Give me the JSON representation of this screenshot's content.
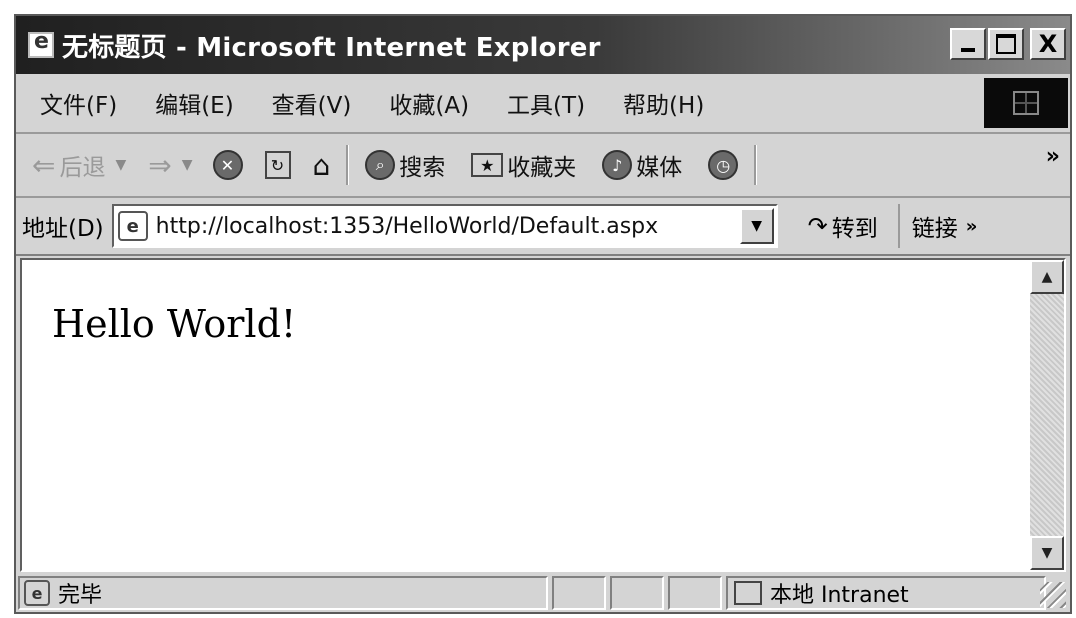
{
  "window": {
    "title": "无标题页 - Microsoft Internet Explorer",
    "minimize": "_",
    "close": "X"
  },
  "menu": {
    "items": [
      "文件(F)",
      "编辑(E)",
      "查看(V)",
      "收藏(A)",
      "工具(T)",
      "帮助(H)"
    ]
  },
  "toolbar": {
    "back": "后退",
    "search": "搜索",
    "favorites": "收藏夹",
    "media": "媒体",
    "more": "»"
  },
  "address": {
    "label": "地址(D)",
    "url": "http://localhost:1353/HelloWorld/Default.aspx",
    "go": "转到",
    "links": "链接",
    "links_more": "»"
  },
  "page": {
    "body_text": "Hello World!"
  },
  "status": {
    "text": "完毕",
    "zone": "本地 Intranet"
  }
}
